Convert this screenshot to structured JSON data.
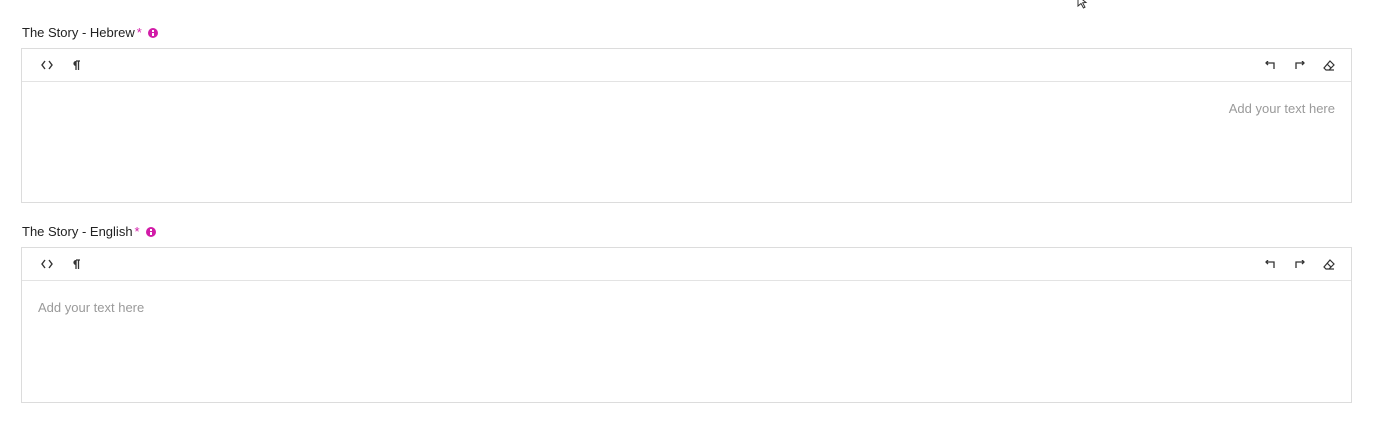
{
  "fields": [
    {
      "label": "The Story - Hebrew",
      "required_mark": "*",
      "placeholder": "Add your text here",
      "direction": "rtl",
      "toolbar": {
        "left": [
          "code-view-icon",
          "paragraph-icon"
        ],
        "right": [
          "undo-icon",
          "redo-icon",
          "clear-format-icon"
        ]
      }
    },
    {
      "label": "The Story - English",
      "required_mark": "*",
      "placeholder": "Add your text here",
      "direction": "ltr",
      "toolbar": {
        "left": [
          "code-view-icon",
          "paragraph-icon"
        ],
        "right": [
          "undo-icon",
          "redo-icon",
          "clear-format-icon"
        ]
      }
    }
  ],
  "colors": {
    "accent": "#d21ca8",
    "border": "#dcdcdc",
    "placeholder": "#9a9a9a"
  }
}
